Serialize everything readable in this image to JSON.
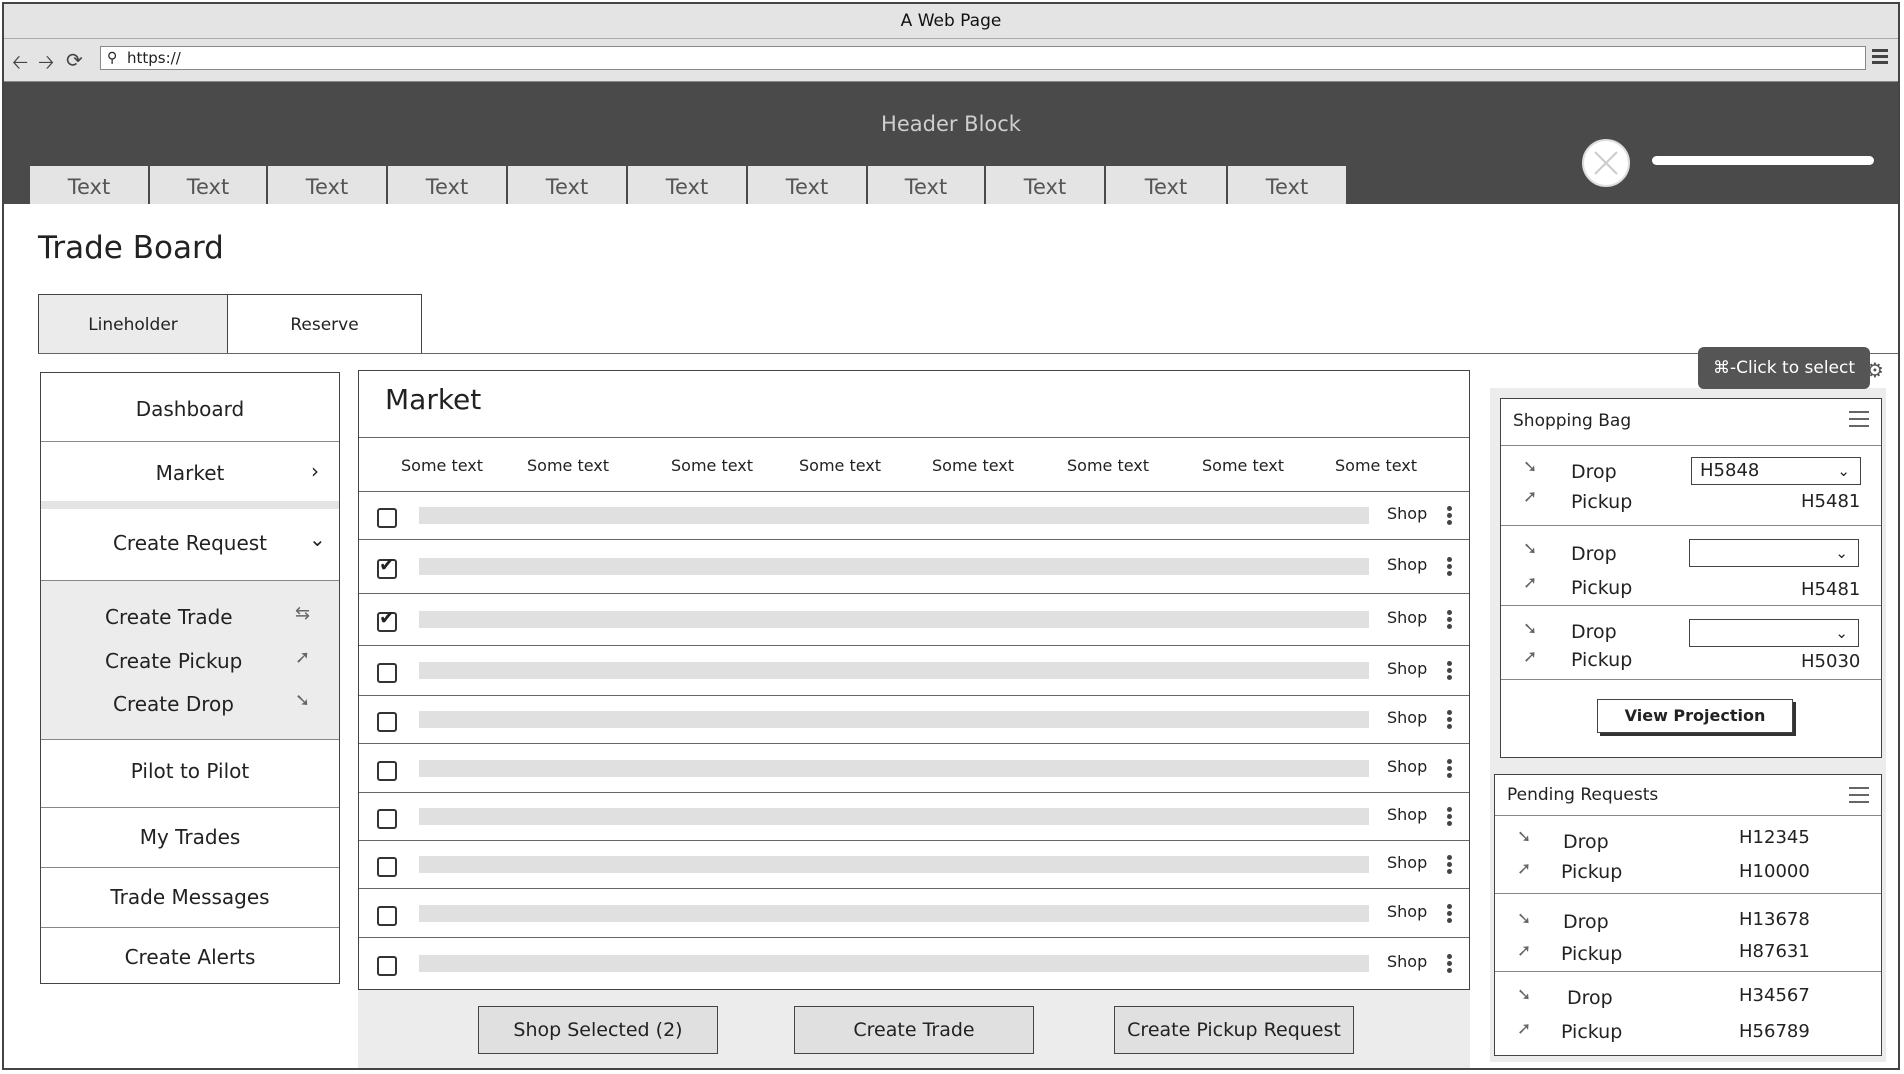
{
  "browser": {
    "title": "A Web Page",
    "url": "https://"
  },
  "header": {
    "title": "Header Block",
    "tabs": [
      "Text",
      "Text",
      "Text",
      "Text",
      "Text",
      "Text",
      "Text",
      "Text",
      "Text",
      "Text",
      "Text"
    ]
  },
  "page": {
    "title": "Trade Board",
    "subtabs": [
      "Lineholder",
      "Reserve"
    ]
  },
  "sidenav": {
    "items": [
      "Dashboard",
      "Market",
      "Create Request",
      "Pilot to Pilot",
      "My Trades",
      "Trade Messages",
      "Create Alerts"
    ],
    "sub_items": [
      "Create Trade",
      "Create Pickup",
      "Create Drop"
    ]
  },
  "market": {
    "title": "Market",
    "columns": [
      "Some text",
      "Some text",
      "Some text",
      "Some text",
      "Some text",
      "Some text",
      "Some text",
      "Some text"
    ],
    "rows": [
      {
        "checked": false,
        "action": "Shop"
      },
      {
        "checked": true,
        "action": "Shop"
      },
      {
        "checked": true,
        "action": "Shop"
      },
      {
        "checked": false,
        "action": "Shop"
      },
      {
        "checked": false,
        "action": "Shop"
      },
      {
        "checked": false,
        "action": "Shop"
      },
      {
        "checked": false,
        "action": "Shop"
      },
      {
        "checked": false,
        "action": "Shop"
      },
      {
        "checked": false,
        "action": "Shop"
      },
      {
        "checked": false,
        "action": "Shop"
      }
    ],
    "actions": [
      "Shop Selected (2)",
      "Create Trade",
      "Create Pickup Request"
    ]
  },
  "tooltip": "⌘-Click to select",
  "shopping_bag": {
    "title": "Shopping Bag",
    "groups": [
      {
        "drop_label": "Drop",
        "drop_select": "H5848",
        "pickup_label": "Pickup",
        "pickup_value": "H5481"
      },
      {
        "drop_label": "Drop",
        "drop_select": "",
        "pickup_label": "Pickup",
        "pickup_value": "H5481"
      },
      {
        "drop_label": "Drop",
        "drop_select": "",
        "pickup_label": "Pickup",
        "pickup_value": "H5030"
      }
    ],
    "button": "View Projection"
  },
  "pending": {
    "title": "Pending Requests",
    "groups": [
      {
        "drop_label": "Drop",
        "drop_value": "H12345",
        "pickup_label": "Pickup",
        "pickup_value": "H10000"
      },
      {
        "drop_label": "Drop",
        "drop_value": "H13678",
        "pickup_label": "Pickup",
        "pickup_value": "H87631"
      },
      {
        "drop_label": "Drop",
        "drop_value": "H34567",
        "pickup_label": "Pickup",
        "pickup_value": "H56789"
      }
    ]
  }
}
